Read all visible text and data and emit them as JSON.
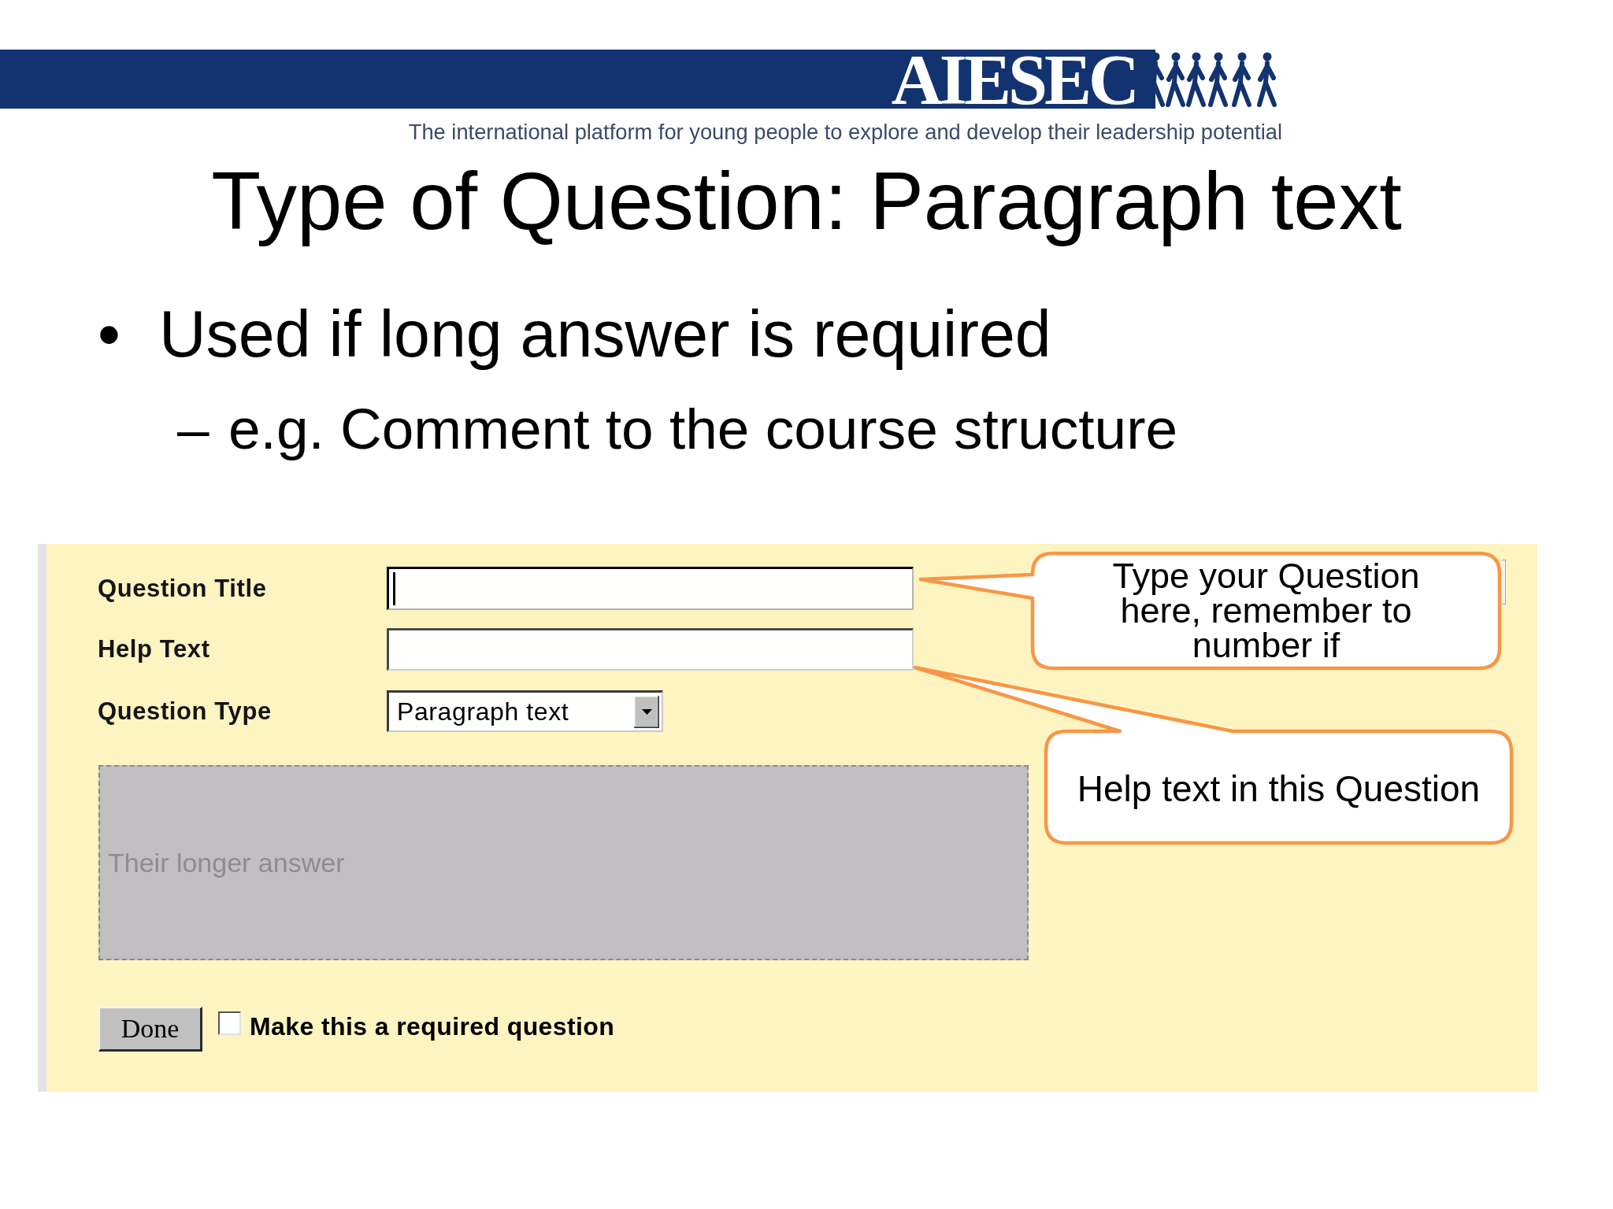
{
  "header": {
    "logo": "AIESEC",
    "tagline": "The international platform for young people to explore and develop their leadership potential"
  },
  "title": "Type of Question: Paragraph text",
  "bullets": [
    {
      "marker": "•",
      "text": "Used if long answer is required",
      "children": [
        {
          "marker": "–",
          "text": "e.g. Comment to the course structure"
        }
      ]
    }
  ],
  "form": {
    "fields": [
      {
        "kind": "text",
        "label": "Question Title",
        "focused": true
      },
      {
        "kind": "text",
        "label": "Help Text",
        "focused": false
      },
      {
        "kind": "select",
        "label": "Question Type",
        "value": "Paragraph text",
        "focused": false
      }
    ],
    "answer_preview": {
      "placeholder": "Their longer answer"
    },
    "done_button": {
      "label": "Done"
    },
    "required_checkbox": {
      "label": "Make this a required question",
      "checked": false
    }
  },
  "callouts": [
    {
      "text": "Type your Question here, remember to number if"
    },
    {
      "text": "Help text in this Question"
    }
  ]
}
